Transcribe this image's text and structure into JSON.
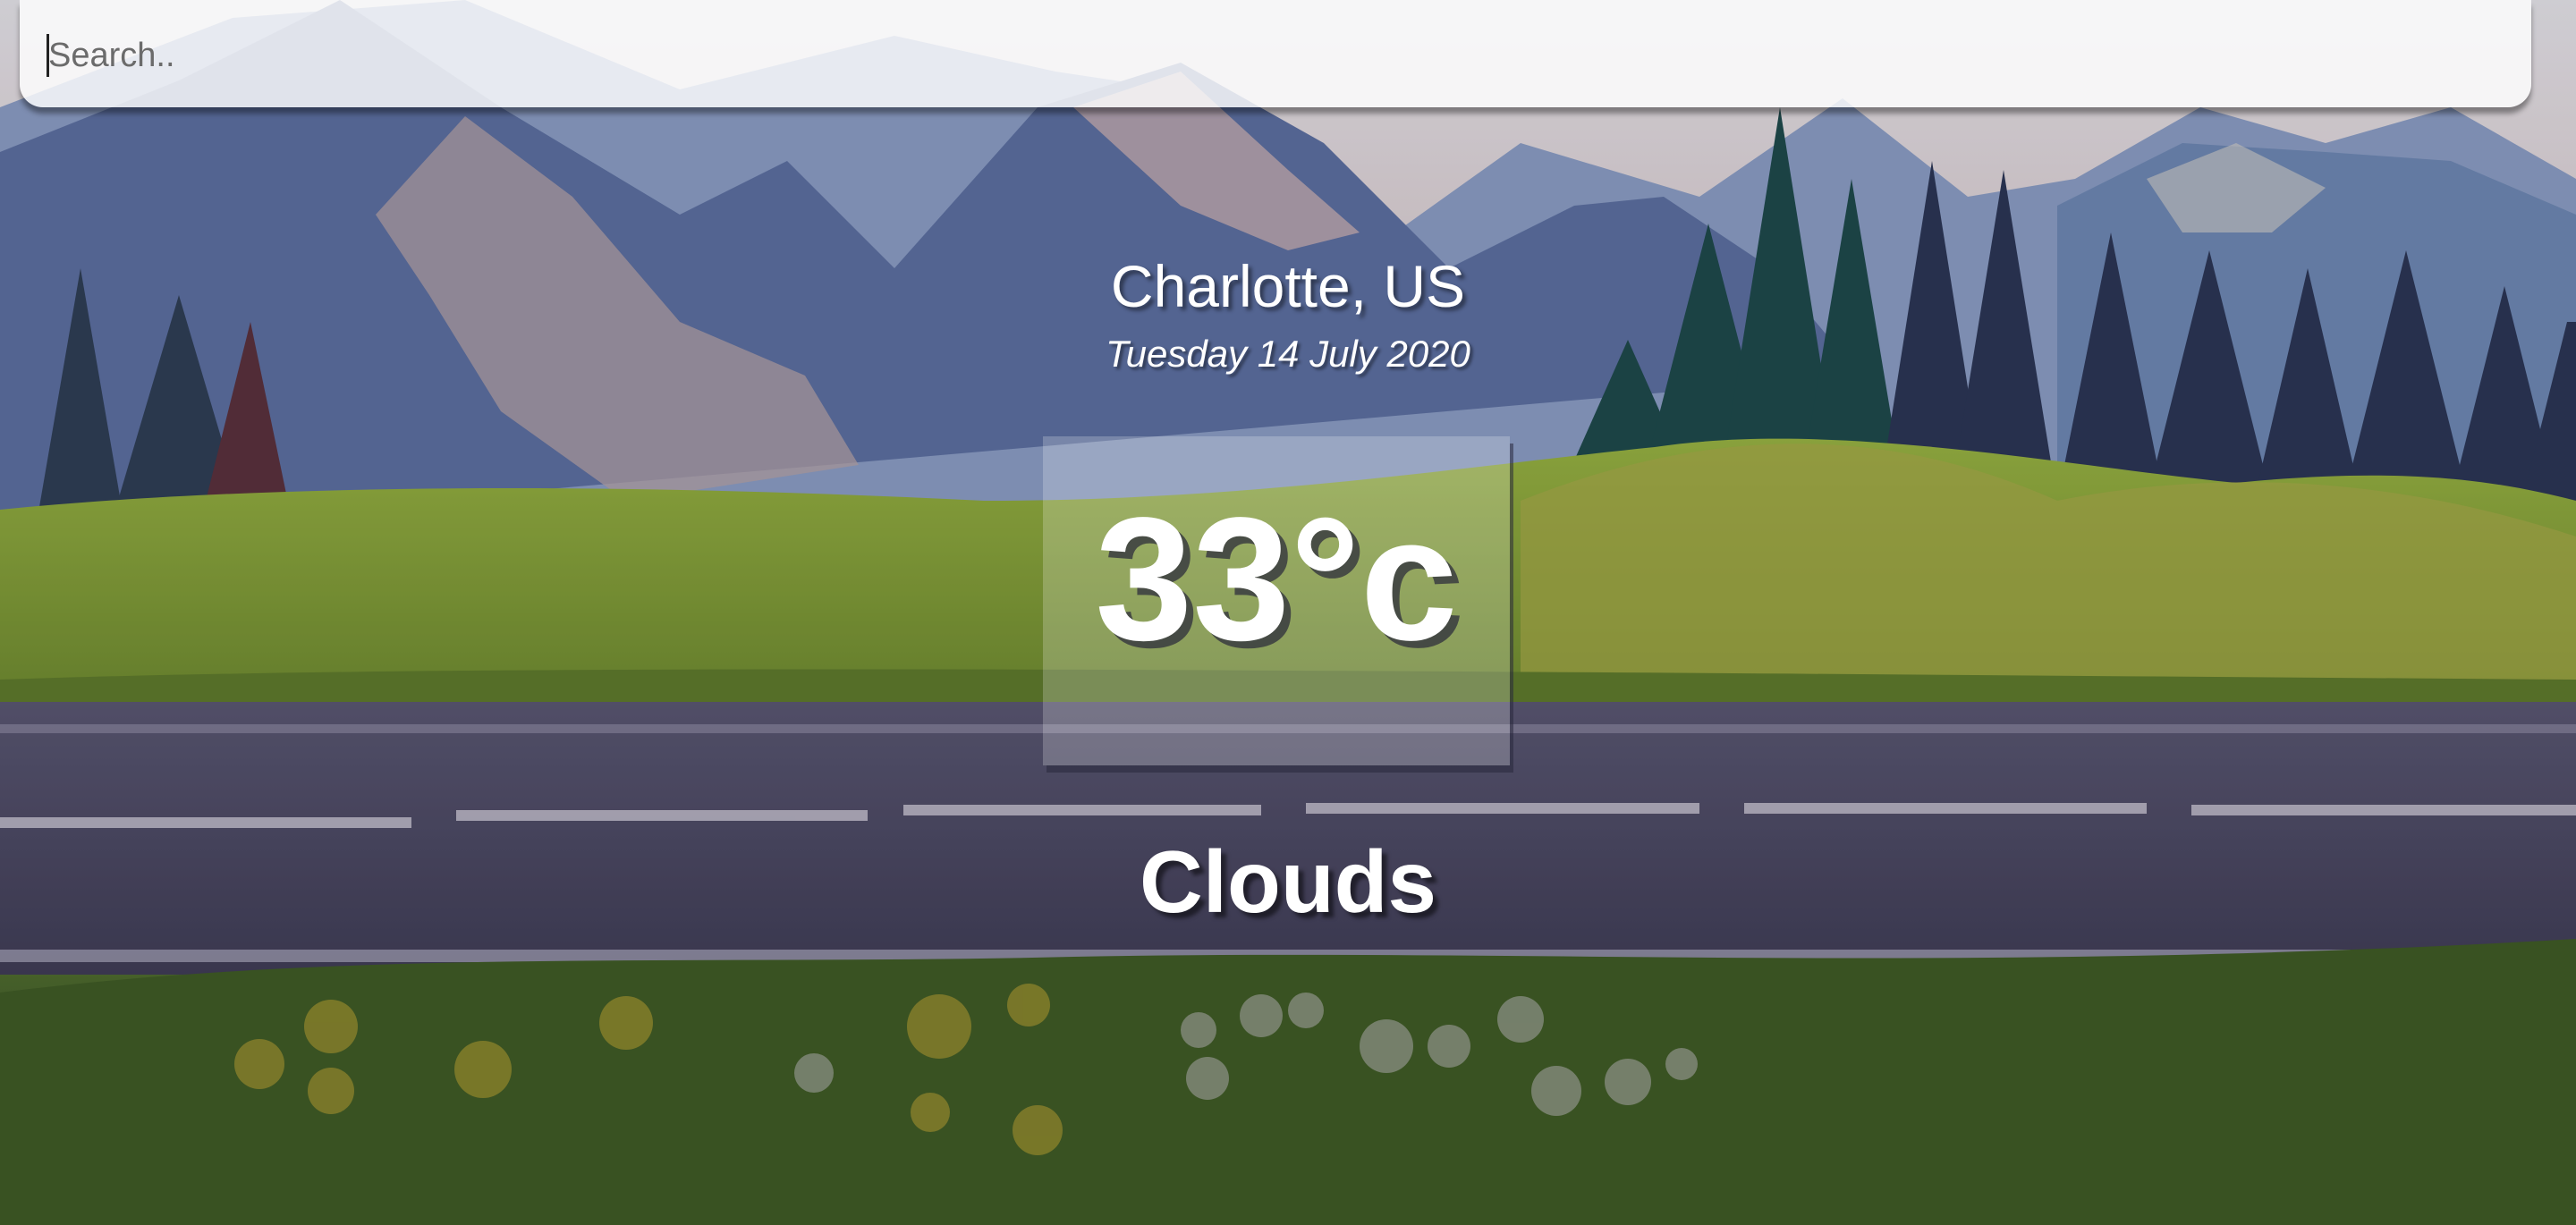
{
  "search": {
    "placeholder": "Search..",
    "value": ""
  },
  "weather": {
    "location": "Charlotte, US",
    "date": "Tuesday 14 July 2020",
    "temperature": "33°c",
    "condition": "Clouds"
  },
  "background": {
    "description_icon": "landscape-background",
    "colors": {
      "sky": "#d9d2d6",
      "mountains": "#6e7fa6",
      "hills": "#8ea83a",
      "road": "#4b4660",
      "foreground": "#3d5a20"
    }
  }
}
